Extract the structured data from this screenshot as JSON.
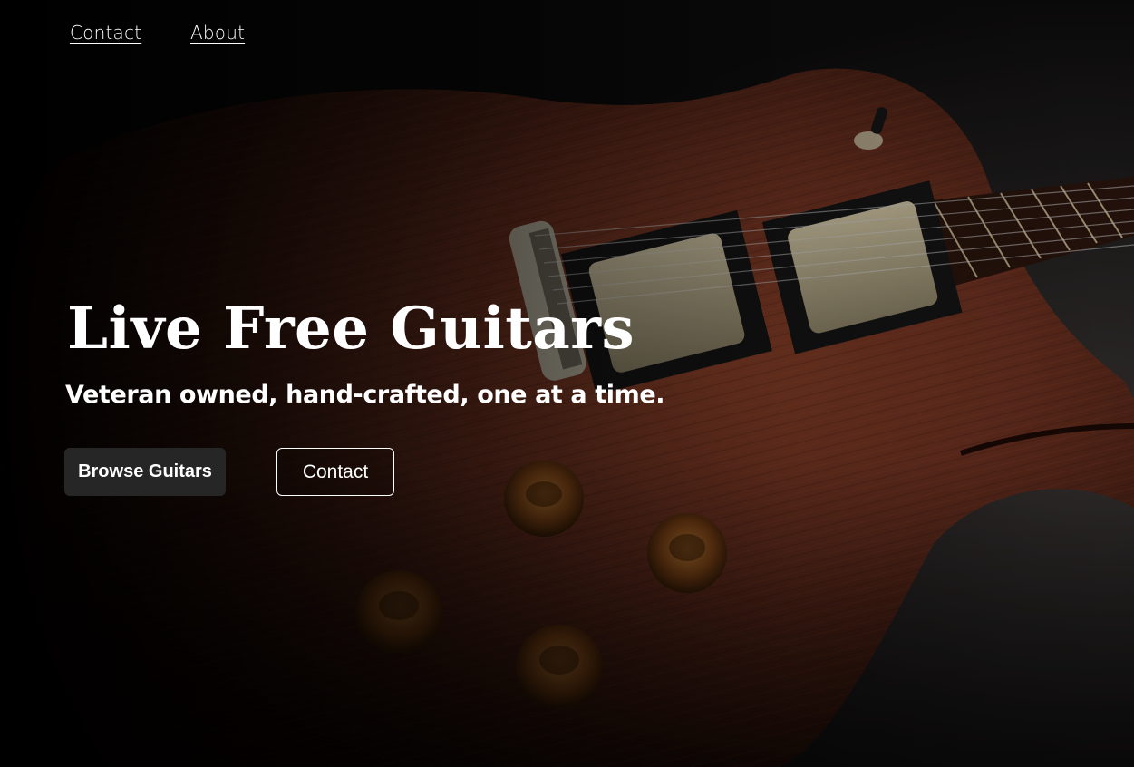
{
  "nav": {
    "links": [
      {
        "label": "Contact"
      },
      {
        "label": "About"
      }
    ]
  },
  "hero": {
    "title": "Live Free Guitars",
    "subtitle": "Veteran owned, hand-crafted, one at a time.",
    "primary_button": "Browse Guitars",
    "secondary_button": "Contact",
    "background_image": "electric guitar body close-up"
  },
  "colors": {
    "text": "#ffffff",
    "primary_button_bg": "#262626",
    "page_bg": "#000000",
    "guitar_body": "#7a3b24"
  }
}
